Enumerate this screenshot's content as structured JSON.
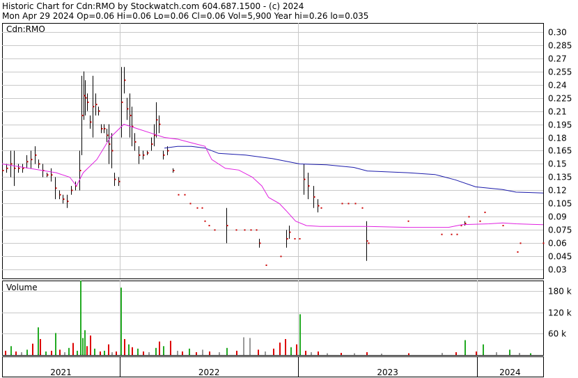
{
  "header": {
    "line1": "Historic Chart for Cdn:RMO by Stockwatch.com 604.687.1500 - (c) 2024",
    "line2": "Mon Apr 29 2024  Op=0.06  Hi=0.06  Lo=0.06  Cl=0.06  Vol=5,900  Year hi=0.26  lo=0.035"
  },
  "colors": {
    "background": "#ffffff",
    "grid": "#c8c8c8",
    "frame": "#000000",
    "price_bar": "#000000",
    "close_dot": "#cc0000",
    "ma_short": "#e020e0",
    "ma_long": "#1a1aaa",
    "vol_up": "#22aa22",
    "vol_down": "#dd0000",
    "vol_flat": "#999999"
  },
  "chart_data": [
    {
      "type": "line",
      "panel": "price",
      "label": "Cdn:RMO",
      "ylim": [
        0.02,
        0.31
      ],
      "yticks": [
        0.3,
        0.285,
        0.27,
        0.255,
        0.24,
        0.225,
        0.21,
        0.195,
        0.18,
        0.165,
        0.15,
        0.135,
        0.12,
        0.105,
        0.09,
        0.075,
        0.06,
        0.045,
        0.03
      ],
      "x_unit": "trading month index (0 = Jan 2021)",
      "xlim": [
        0,
        40
      ],
      "grid": true,
      "price_bars": [
        [
          0.0,
          0.15,
          0.135
        ],
        [
          0.3,
          0.15,
          0.14
        ],
        [
          0.6,
          0.165,
          0.135
        ],
        [
          0.9,
          0.165,
          0.125
        ],
        [
          1.2,
          0.15,
          0.14
        ],
        [
          1.5,
          0.15,
          0.14
        ],
        [
          1.8,
          0.16,
          0.145
        ],
        [
          2.1,
          0.165,
          0.145
        ],
        [
          2.4,
          0.17,
          0.15
        ],
        [
          2.7,
          0.155,
          0.145
        ],
        [
          3.0,
          0.15,
          0.135
        ],
        [
          3.3,
          0.14,
          0.135
        ],
        [
          3.6,
          0.145,
          0.13
        ],
        [
          3.9,
          0.135,
          0.11
        ],
        [
          4.2,
          0.12,
          0.11
        ],
        [
          4.5,
          0.115,
          0.105
        ],
        [
          4.8,
          0.115,
          0.1
        ],
        [
          5.1,
          0.125,
          0.115
        ],
        [
          5.4,
          0.13,
          0.12
        ],
        [
          5.7,
          0.165,
          0.12
        ],
        [
          5.85,
          0.25,
          0.16
        ],
        [
          6.0,
          0.255,
          0.2
        ],
        [
          6.15,
          0.245,
          0.205
        ],
        [
          6.3,
          0.23,
          0.21
        ],
        [
          6.5,
          0.205,
          0.19
        ],
        [
          6.7,
          0.25,
          0.18
        ],
        [
          6.9,
          0.23,
          0.205
        ],
        [
          7.1,
          0.215,
          0.205
        ],
        [
          7.3,
          0.195,
          0.185
        ],
        [
          7.5,
          0.195,
          0.185
        ],
        [
          7.7,
          0.19,
          0.175
        ],
        [
          7.9,
          0.195,
          0.15
        ],
        [
          8.1,
          0.185,
          0.145
        ],
        [
          8.3,
          0.14,
          0.125
        ],
        [
          8.6,
          0.135,
          0.125
        ],
        [
          8.8,
          0.26,
          0.18
        ],
        [
          9.0,
          0.26,
          0.23
        ],
        [
          9.2,
          0.225,
          0.2
        ],
        [
          9.4,
          0.23,
          0.18
        ],
        [
          9.6,
          0.215,
          0.17
        ],
        [
          9.8,
          0.185,
          0.165
        ],
        [
          10.1,
          0.17,
          0.15
        ],
        [
          10.4,
          0.165,
          0.155
        ],
        [
          10.7,
          0.165,
          0.16
        ],
        [
          11.0,
          0.18,
          0.165
        ],
        [
          11.2,
          0.195,
          0.17
        ],
        [
          11.4,
          0.22,
          0.18
        ],
        [
          11.6,
          0.205,
          0.185
        ],
        [
          11.9,
          0.165,
          0.155
        ],
        [
          12.2,
          0.17,
          0.16
        ],
        [
          12.6,
          0.145,
          0.14
        ],
        [
          13.0,
          0.115,
          0.115
        ],
        [
          13.5,
          0.115,
          0.115
        ],
        [
          13.9,
          0.105,
          0.105
        ],
        [
          14.4,
          0.1,
          0.1
        ],
        [
          14.8,
          0.1,
          0.1
        ],
        [
          15.0,
          0.085,
          0.085
        ],
        [
          15.3,
          0.08,
          0.08
        ],
        [
          15.7,
          0.075,
          0.075
        ],
        [
          16.6,
          0.1,
          0.06
        ],
        [
          17.3,
          0.075,
          0.075
        ],
        [
          17.9,
          0.075,
          0.075
        ],
        [
          18.4,
          0.075,
          0.075
        ],
        [
          18.8,
          0.075,
          0.075
        ],
        [
          19.0,
          0.065,
          0.055
        ],
        [
          19.5,
          0.035,
          0.035
        ],
        [
          20.6,
          0.045,
          0.045
        ],
        [
          21.0,
          0.075,
          0.055
        ],
        [
          21.2,
          0.08,
          0.065
        ],
        [
          21.6,
          0.065,
          0.065
        ],
        [
          22.0,
          0.065,
          0.065
        ],
        [
          22.3,
          0.15,
          0.115
        ],
        [
          22.6,
          0.14,
          0.11
        ],
        [
          23.0,
          0.125,
          0.1
        ],
        [
          23.3,
          0.11,
          0.095
        ],
        [
          23.6,
          0.1,
          0.1
        ],
        [
          25.1,
          0.105,
          0.105
        ],
        [
          25.6,
          0.105,
          0.105
        ],
        [
          26.1,
          0.105,
          0.105
        ],
        [
          26.6,
          0.1,
          0.1
        ],
        [
          26.9,
          0.085,
          0.04
        ],
        [
          27.1,
          0.06,
          0.06
        ],
        [
          30.0,
          0.085,
          0.085
        ],
        [
          32.5,
          0.07,
          0.07
        ],
        [
          33.2,
          0.07,
          0.07
        ],
        [
          33.6,
          0.07,
          0.07
        ],
        [
          33.9,
          0.08,
          0.08
        ],
        [
          34.2,
          0.085,
          0.08
        ],
        [
          34.5,
          0.09,
          0.09
        ],
        [
          35.3,
          0.085,
          0.085
        ],
        [
          35.7,
          0.095,
          0.095
        ],
        [
          37.0,
          0.08,
          0.08
        ],
        [
          38.1,
          0.05,
          0.05
        ],
        [
          38.3,
          0.06,
          0.06
        ],
        [
          40.0,
          0.06,
          0.06
        ]
      ],
      "ma_short": [
        [
          0,
          0.15
        ],
        [
          2,
          0.145
        ],
        [
          4,
          0.14
        ],
        [
          5,
          0.135
        ],
        [
          5.5,
          0.125
        ],
        [
          6,
          0.14
        ],
        [
          7,
          0.155
        ],
        [
          8,
          0.18
        ],
        [
          9,
          0.195
        ],
        [
          10,
          0.19
        ],
        [
          11,
          0.185
        ],
        [
          12,
          0.18
        ],
        [
          13,
          0.178
        ],
        [
          14,
          0.174
        ],
        [
          15,
          0.17
        ],
        [
          15.5,
          0.155
        ],
        [
          16.5,
          0.145
        ],
        [
          17.5,
          0.143
        ],
        [
          18.5,
          0.135
        ],
        [
          19.2,
          0.125
        ],
        [
          19.7,
          0.112
        ],
        [
          20.5,
          0.105
        ],
        [
          21,
          0.097
        ],
        [
          21.7,
          0.085
        ],
        [
          22.5,
          0.08
        ],
        [
          23.5,
          0.079
        ],
        [
          25,
          0.079
        ],
        [
          27,
          0.079
        ],
        [
          30,
          0.078
        ],
        [
          33,
          0.078
        ],
        [
          34,
          0.081
        ],
        [
          36,
          0.082
        ],
        [
          37,
          0.083
        ],
        [
          38,
          0.082
        ],
        [
          40,
          0.081
        ]
      ],
      "ma_long": [
        [
          12,
          0.168
        ],
        [
          13,
          0.17
        ],
        [
          14,
          0.17
        ],
        [
          15,
          0.168
        ],
        [
          16,
          0.162
        ],
        [
          18,
          0.16
        ],
        [
          20,
          0.156
        ],
        [
          22,
          0.15
        ],
        [
          24,
          0.149
        ],
        [
          26,
          0.146
        ],
        [
          27,
          0.142
        ],
        [
          30,
          0.14
        ],
        [
          32,
          0.138
        ],
        [
          33.5,
          0.132
        ],
        [
          35,
          0.124
        ],
        [
          37,
          0.121
        ],
        [
          38,
          0.118
        ],
        [
          40,
          0.117
        ]
      ]
    },
    {
      "type": "bar",
      "panel": "volume",
      "label": "Volume",
      "ylim": [
        0,
        210000
      ],
      "yticks": [
        "60 k",
        "120 k",
        "180 k"
      ],
      "ytick_values": [
        60000,
        120000,
        180000
      ],
      "bars": [
        [
          0.2,
          12000,
          "down"
        ],
        [
          0.6,
          25000,
          "up"
        ],
        [
          1.0,
          10000,
          "down"
        ],
        [
          1.4,
          8000,
          "flat"
        ],
        [
          1.8,
          15000,
          "up"
        ],
        [
          2.2,
          32000,
          "down"
        ],
        [
          2.6,
          78000,
          "up"
        ],
        [
          2.8,
          45000,
          "down"
        ],
        [
          3.2,
          10000,
          "up"
        ],
        [
          3.6,
          12000,
          "down"
        ],
        [
          3.9,
          62000,
          "up"
        ],
        [
          4.2,
          15000,
          "down"
        ],
        [
          4.6,
          8000,
          "flat"
        ],
        [
          4.9,
          20000,
          "up"
        ],
        [
          5.2,
          34000,
          "down"
        ],
        [
          5.5,
          12000,
          "up"
        ],
        [
          5.75,
          210000,
          "up"
        ],
        [
          5.9,
          48000,
          "up"
        ],
        [
          6.05,
          70000,
          "up"
        ],
        [
          6.25,
          25000,
          "down"
        ],
        [
          6.5,
          55000,
          "down"
        ],
        [
          6.8,
          18000,
          "up"
        ],
        [
          7.2,
          10000,
          "down"
        ],
        [
          7.5,
          12000,
          "up"
        ],
        [
          7.8,
          30000,
          "down"
        ],
        [
          8.1,
          8000,
          "flat"
        ],
        [
          8.4,
          10000,
          "down"
        ],
        [
          8.75,
          190000,
          "up"
        ],
        [
          9.0,
          45000,
          "down"
        ],
        [
          9.3,
          30000,
          "up"
        ],
        [
          9.6,
          22000,
          "down"
        ],
        [
          10.0,
          18000,
          "up"
        ],
        [
          10.4,
          10000,
          "down"
        ],
        [
          10.8,
          8000,
          "flat"
        ],
        [
          11.3,
          20000,
          "up"
        ],
        [
          11.6,
          38000,
          "down"
        ],
        [
          11.9,
          25000,
          "up"
        ],
        [
          12.4,
          40000,
          "down"
        ],
        [
          12.9,
          12000,
          "flat"
        ],
        [
          13.3,
          10000,
          "down"
        ],
        [
          13.8,
          18000,
          "up"
        ],
        [
          14.3,
          8000,
          "down"
        ],
        [
          14.8,
          15000,
          "flat"
        ],
        [
          15.3,
          10000,
          "down"
        ],
        [
          16.0,
          8000,
          "flat"
        ],
        [
          16.6,
          20000,
          "up"
        ],
        [
          17.3,
          12000,
          "down"
        ],
        [
          17.8,
          50000,
          "flat"
        ],
        [
          18.3,
          48000,
          "flat"
        ],
        [
          18.9,
          15000,
          "down"
        ],
        [
          19.4,
          10000,
          "flat"
        ],
        [
          20.0,
          18000,
          "down"
        ],
        [
          20.5,
          35000,
          "down"
        ],
        [
          20.9,
          45000,
          "down"
        ],
        [
          21.3,
          22000,
          "up"
        ],
        [
          21.7,
          30000,
          "down"
        ],
        [
          22.0,
          115000,
          "up"
        ],
        [
          22.4,
          12000,
          "down"
        ],
        [
          22.8,
          8000,
          "flat"
        ],
        [
          23.3,
          10000,
          "down"
        ],
        [
          24.0,
          5000,
          "flat"
        ],
        [
          25.0,
          6000,
          "down"
        ],
        [
          26.0,
          5000,
          "flat"
        ],
        [
          26.9,
          8000,
          "down"
        ],
        [
          28.0,
          4000,
          "flat"
        ],
        [
          30.0,
          5000,
          "down"
        ],
        [
          32.5,
          6000,
          "flat"
        ],
        [
          33.5,
          8000,
          "down"
        ],
        [
          34.2,
          42000,
          "up"
        ],
        [
          35.0,
          10000,
          "down"
        ],
        [
          35.5,
          30000,
          "up"
        ],
        [
          36.5,
          8000,
          "flat"
        ],
        [
          37.5,
          15000,
          "up"
        ],
        [
          38.2,
          6000,
          "flat"
        ],
        [
          39.0,
          5000,
          "up"
        ]
      ]
    }
  ],
  "x_axis": {
    "labels": [
      "2021",
      "2022",
      "2023",
      "2024"
    ],
    "year_starts": [
      0,
      8.7,
      21.9,
      35.1
    ],
    "xlim": [
      0,
      40
    ]
  }
}
